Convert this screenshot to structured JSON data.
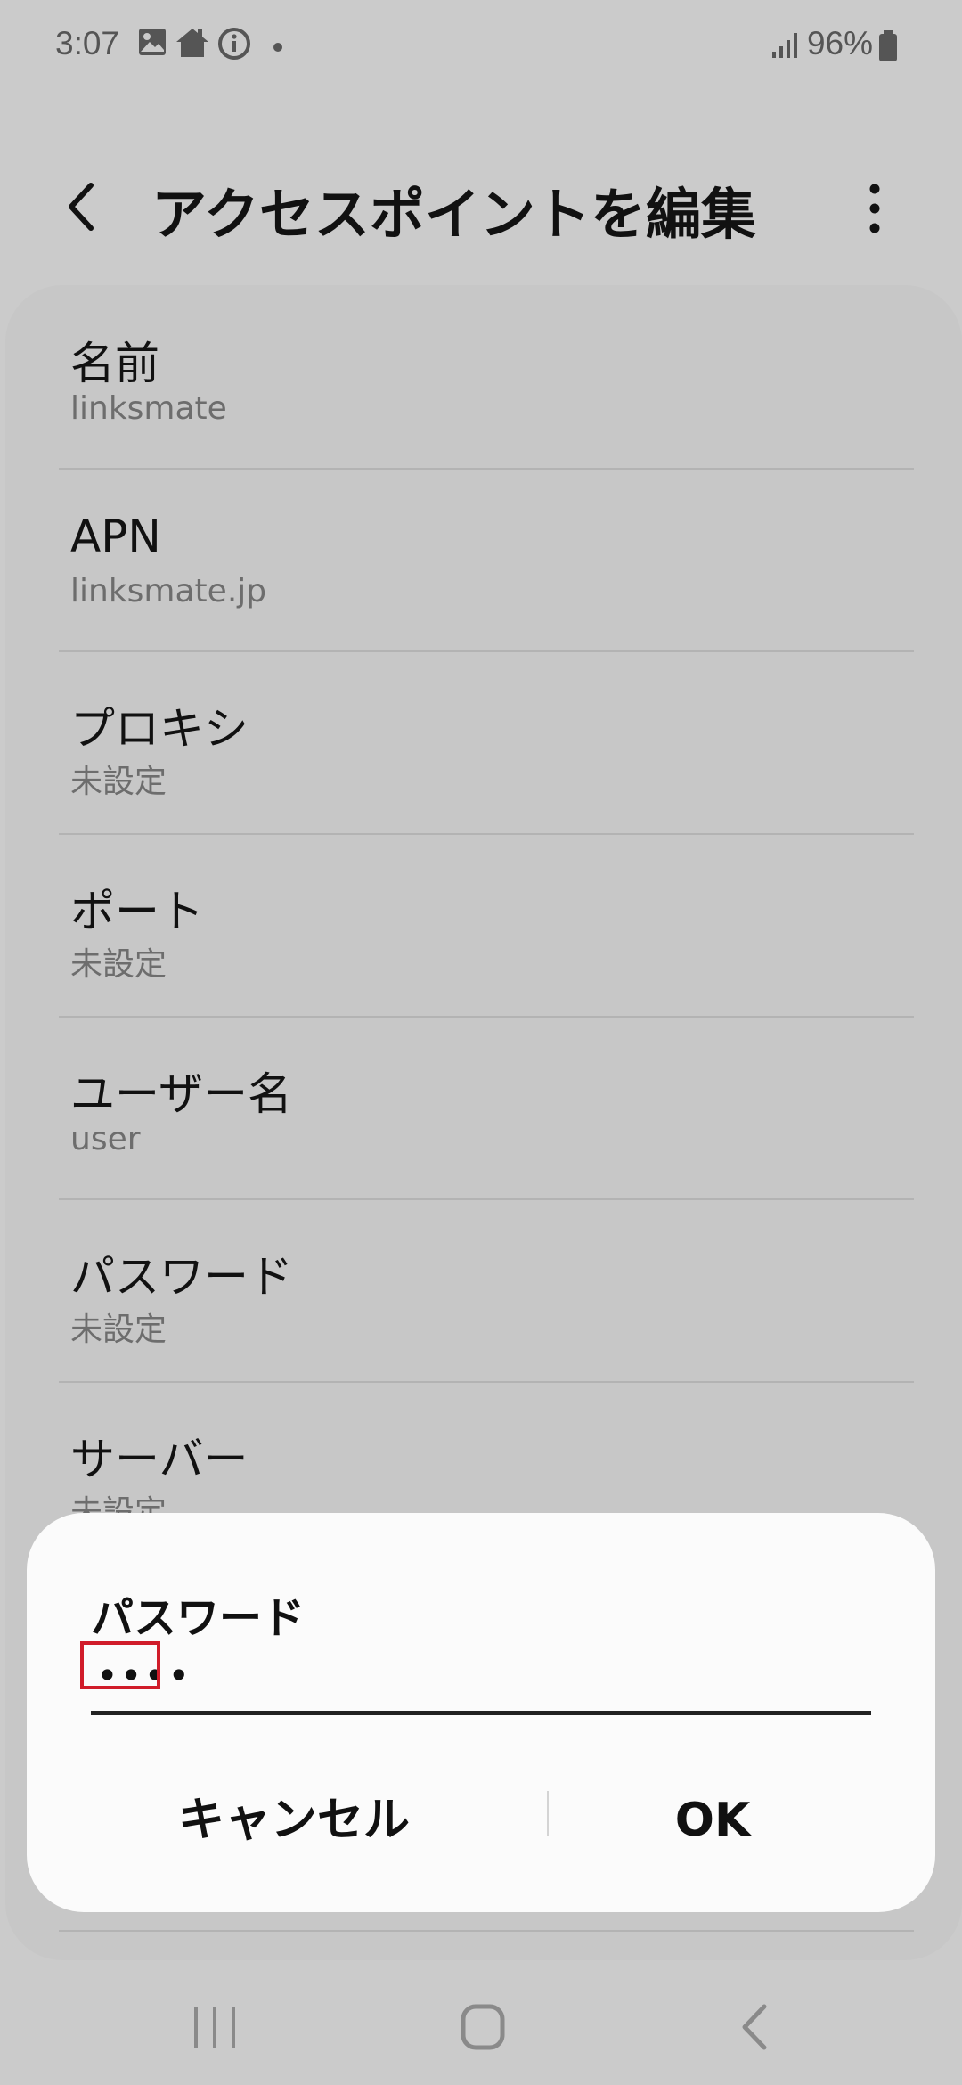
{
  "status_bar": {
    "time": "3:07",
    "battery": "96%",
    "icons": [
      "image-icon",
      "home-icon",
      "info-icon",
      "notification-dot-icon",
      "signal-icon",
      "battery-icon"
    ]
  },
  "header": {
    "title": "アクセスポイントを編集",
    "back_icon": "back-arrow-icon",
    "more_icon": "more-options-icon"
  },
  "settings": [
    {
      "label": "名前",
      "value": "linksmate"
    },
    {
      "label": "APN",
      "value": "linksmate.jp"
    },
    {
      "label": "プロキシ",
      "value": "未設定"
    },
    {
      "label": "ポート",
      "value": "未設定"
    },
    {
      "label": "ユーザー名",
      "value": "user"
    },
    {
      "label": "パスワード",
      "value": "未設定"
    },
    {
      "label": "サーバー",
      "value": "未設定"
    }
  ],
  "dialog": {
    "title": "パスワード",
    "input_value": "••••",
    "cancel_label": "キャンセル",
    "ok_label": "OK",
    "highlight_color": "#d01c2a"
  },
  "nav_bar": {
    "icons": [
      "recent-apps-icon",
      "home-icon",
      "back-icon"
    ]
  }
}
